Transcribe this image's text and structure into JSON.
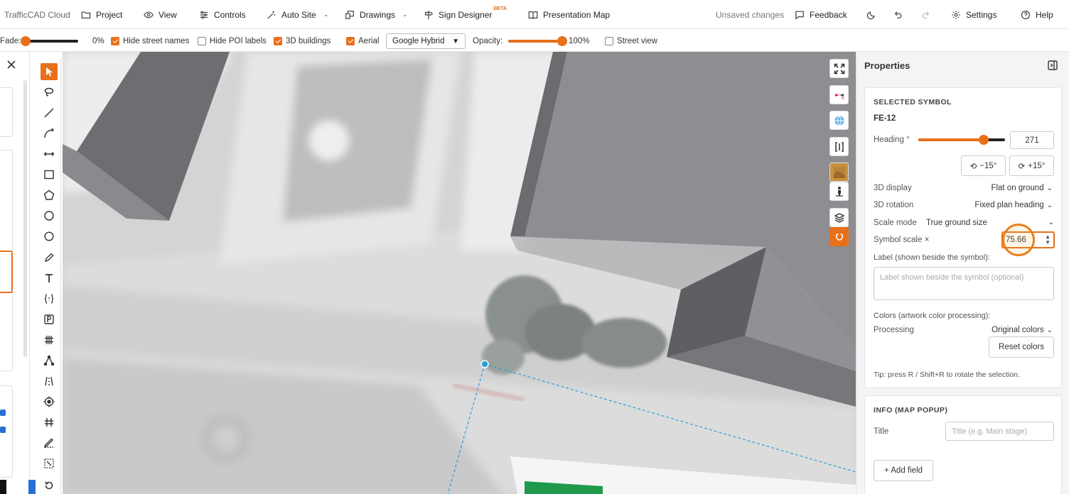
{
  "menubar": {
    "brand": "TrafficCAD Cloud",
    "project": "Project",
    "view": "View",
    "controls": "Controls",
    "auto_site": "Auto Site",
    "drawings": "Drawings",
    "sign_designer": "Sign Designer",
    "beta": "BETA",
    "presentation_map": "Presentation Map",
    "status": "Unsaved changes",
    "feedback": "Feedback",
    "settings": "Settings",
    "help": "Help"
  },
  "optbar": {
    "fade_label": "Fade:",
    "fade_value": "0%",
    "fade_level": 0,
    "hide_street_names": {
      "label": "Hide street names",
      "checked": true
    },
    "hide_poi_labels": {
      "label": "Hide POI labels",
      "checked": false
    },
    "buildings_3d": {
      "label": "3D buildings",
      "checked": true
    },
    "aerial": {
      "label": "Aerial",
      "checked": true
    },
    "basemap": "Google Hybrid",
    "opacity_label": "Opacity:",
    "opacity_value": "100%",
    "opacity_level": 100,
    "street_view": {
      "label": "Street view",
      "checked": false
    }
  },
  "properties": {
    "title": "Properties",
    "selected_symbol": {
      "section_title": "SELECTED SYMBOL",
      "symbol_code": "FE-12",
      "heading_label": "Heading °",
      "heading_value": "271",
      "heading_level": 271,
      "rotate_minus": "−15°",
      "rotate_plus": "+15°",
      "display_3d_label": "3D display",
      "display_3d_value": "Flat on ground",
      "rotation_3d_label": "3D rotation",
      "rotation_3d_value": "Fixed plan heading",
      "scale_mode_label": "Scale mode",
      "scale_mode_value": "True ground size",
      "symbol_scale_label": "Symbol scale ×",
      "symbol_scale_value": "75.66",
      "label_field_label": "Label (shown beside the symbol):",
      "label_placeholder": "Label shown beside the symbol (optional)",
      "colors_label": "Colors (artwork color processing):",
      "processing_label": "Processing",
      "processing_value": "Original colors",
      "reset_colors": "Reset colors",
      "tip": "Tip: press R / Shift+R to rotate the selection."
    },
    "info": {
      "section_title": "INFO (MAP POPUP)",
      "title_label": "Title",
      "title_placeholder": "Title (e.g. Main stage)",
      "add_field": "+ Add field"
    }
  },
  "colors": {
    "accent": "#e8701a",
    "link_line": "#2aa0d8"
  }
}
